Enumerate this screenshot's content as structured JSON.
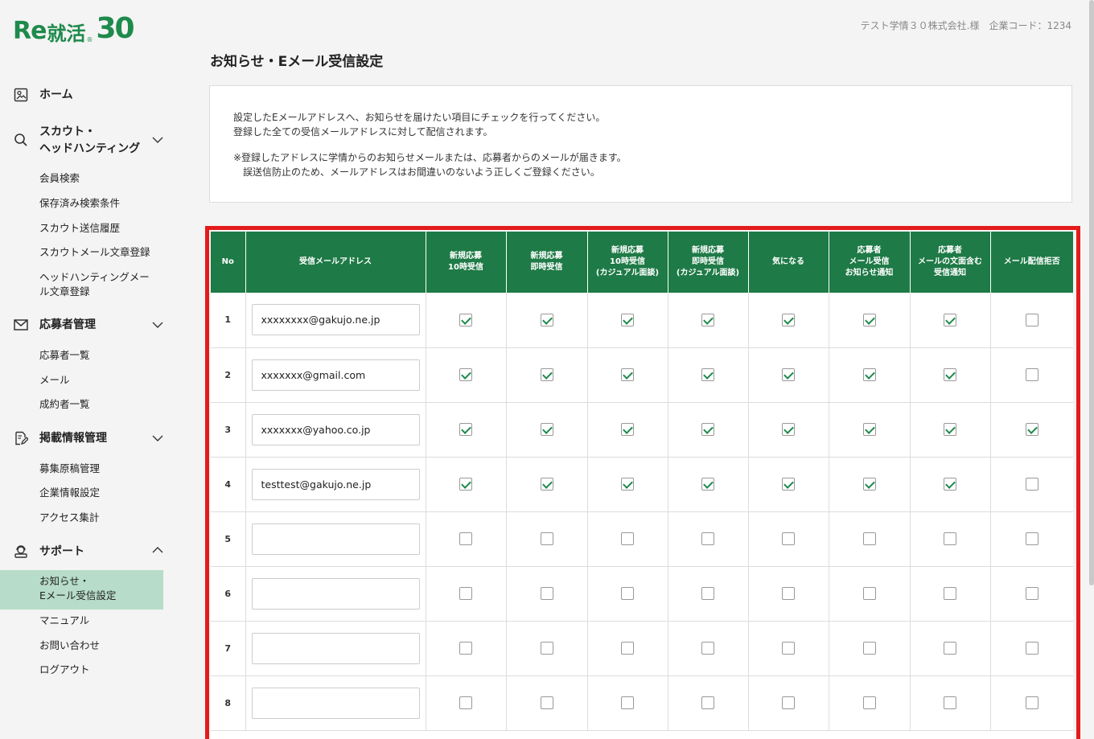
{
  "brand": {
    "re": "Re",
    "shu": "就活",
    "num": "30",
    "reg": "®"
  },
  "header": {
    "company": "テスト学情３０株式会社.様　企業コード：1234",
    "title": "お知らせ・Eメール受信設定"
  },
  "sidebar": {
    "home": "ホーム",
    "scout": {
      "label_line1": "スカウト・",
      "label_line2": "ヘッドハンティング",
      "items": [
        "会員検索",
        "保存済み検索条件",
        "スカウト送信履歴",
        "スカウトメール文章登録",
        "ヘッドハンティングメー",
        "ル文章登録"
      ]
    },
    "applicants": {
      "label": "応募者管理",
      "items": [
        "応募者一覧",
        "メール",
        "成約者一覧"
      ]
    },
    "posting": {
      "label": "掲載情報管理",
      "items": [
        "募集原稿管理",
        "企業情報設定",
        "アクセス集計"
      ]
    },
    "support": {
      "label": "サポート",
      "active_line1": "お知らせ・",
      "active_line2": "Eメール受信設定",
      "items": [
        "マニュアル",
        "お問い合わせ",
        "ログアウト"
      ]
    }
  },
  "info": {
    "line1": "設定したEメールアドレスへ、お知らせを届けたい項目にチェックを行ってください。",
    "line2": "登録した全ての受信メールアドレスに対して配信されます。",
    "line3": "※登録したアドレスに学情からのお知らせメールまたは、応募者からのメールが届きます。",
    "line4": "　誤送信防止のため、メールアドレスはお間違いのないよう正しくご登録ください。"
  },
  "table": {
    "headers": [
      [
        "No"
      ],
      [
        "受信メールアドレス"
      ],
      [
        "新規応募",
        "10時受信"
      ],
      [
        "新規応募",
        "即時受信"
      ],
      [
        "新規応募",
        "10時受信",
        "(カジュアル面談)"
      ],
      [
        "新規応募",
        "即時受信",
        "(カジュアル面談)"
      ],
      [
        "気になる"
      ],
      [
        "応募者",
        "メール受信",
        "お知らせ通知"
      ],
      [
        "応募者",
        "メールの文面含む",
        "受信通知"
      ],
      [
        "メール配信拒否"
      ]
    ],
    "rows": [
      {
        "no": "1",
        "email": "xxxxxxxx@gakujo.ne.jp",
        "checks": [
          true,
          true,
          true,
          true,
          true,
          true,
          true,
          false
        ]
      },
      {
        "no": "2",
        "email": "xxxxxxx@gmail.com",
        "checks": [
          true,
          true,
          true,
          true,
          true,
          true,
          true,
          false
        ]
      },
      {
        "no": "3",
        "email": "xxxxxxx@yahoo.co.jp",
        "checks": [
          true,
          true,
          true,
          true,
          true,
          true,
          true,
          true
        ]
      },
      {
        "no": "4",
        "email": "testtest@gakujo.ne.jp",
        "checks": [
          true,
          true,
          true,
          true,
          true,
          true,
          true,
          false
        ]
      },
      {
        "no": "5",
        "email": "",
        "checks": [
          false,
          false,
          false,
          false,
          false,
          false,
          false,
          false
        ]
      },
      {
        "no": "6",
        "email": "",
        "checks": [
          false,
          false,
          false,
          false,
          false,
          false,
          false,
          false
        ]
      },
      {
        "no": "7",
        "email": "",
        "checks": [
          false,
          false,
          false,
          false,
          false,
          false,
          false,
          false
        ]
      },
      {
        "no": "8",
        "email": "",
        "checks": [
          false,
          false,
          false,
          false,
          false,
          false,
          false,
          false
        ]
      }
    ]
  },
  "colors": {
    "brand_green": "#1e7a46",
    "highlight_red": "#e31b1b",
    "active_bg": "#b7dcc9"
  }
}
